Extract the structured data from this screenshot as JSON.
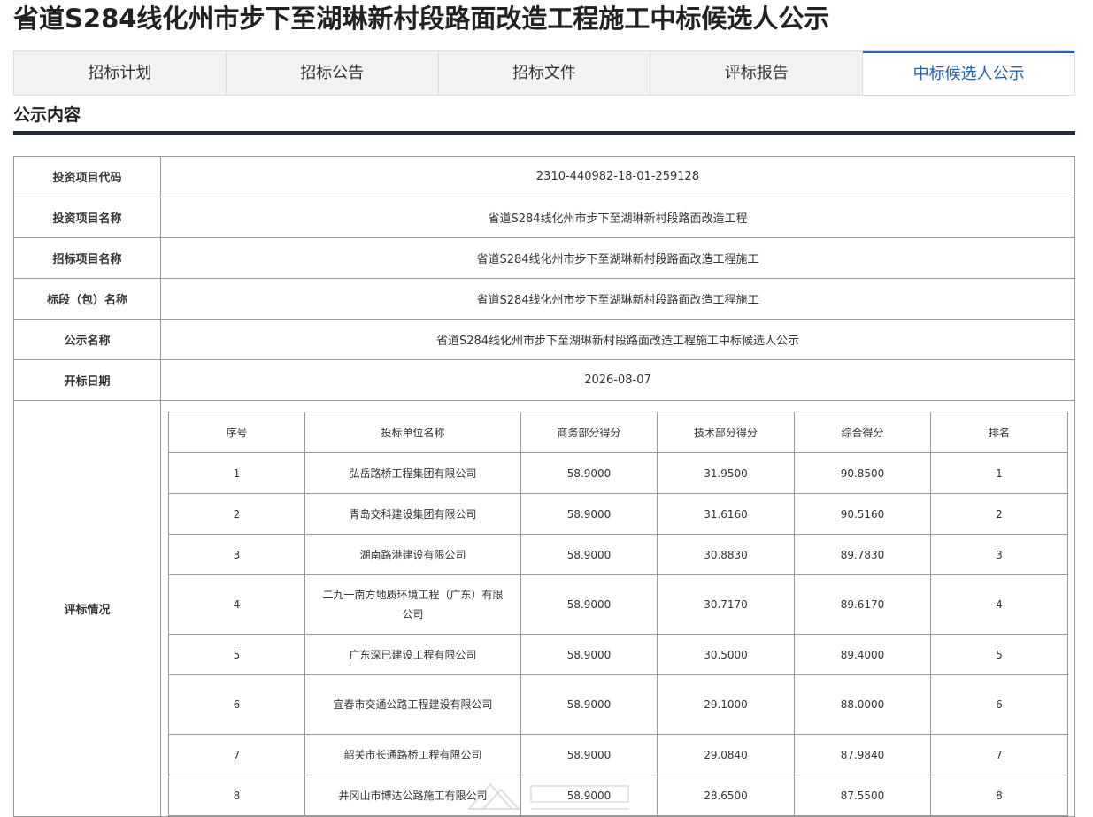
{
  "page": {
    "title": "省道S284线化州市步下至湖琳新村段路面改造工程施工中标候选人公示"
  },
  "tabs": [
    {
      "label": "招标计划"
    },
    {
      "label": "招标公告"
    },
    {
      "label": "招标文件"
    },
    {
      "label": "评标报告"
    },
    {
      "label": "中标候选人公示",
      "active": true
    }
  ],
  "section": {
    "title": "公示内容"
  },
  "info": {
    "project_code_label": "投资项目代码",
    "project_code": "2310-440982-18-01-259128",
    "project_name_label": "投资项目名称",
    "project_name": "省道S284线化州市步下至湖琳新村段路面改造工程",
    "tender_name_label": "招标项目名称",
    "tender_name": "省道S284线化州市步下至湖琳新村段路面改造工程施工",
    "section_name_label": "标段（包）名称",
    "section_name": "省道S284线化州市步下至湖琳新村段路面改造工程施工",
    "notice_name_label": "公示名称",
    "notice_name": "省道S284线化州市步下至湖琳新村段路面改造工程施工中标候选人公示",
    "open_date_label": "开标日期",
    "open_date": "2026-08-07",
    "evaluation_label": "评标情况"
  },
  "evaluation": {
    "headers": [
      "序号",
      "投标单位名称",
      "商务部分得分",
      "技术部分得分",
      "综合得分",
      "排名"
    ],
    "rows": [
      [
        "1",
        "弘岳路桥工程集团有限公司",
        "58.9000",
        "31.9500",
        "90.8500",
        "1"
      ],
      [
        "2",
        "青岛交科建设集团有限公司",
        "58.9000",
        "31.6160",
        "90.5160",
        "2"
      ],
      [
        "3",
        "湖南路港建设有限公司",
        "58.9000",
        "30.8830",
        "89.7830",
        "3"
      ],
      [
        "4",
        "二九一南方地质环境工程（广东）有限公司",
        "58.9000",
        "30.7170",
        "89.6170",
        "4"
      ],
      [
        "5",
        "广东深已建设工程有限公司",
        "58.9000",
        "30.5000",
        "89.4000",
        "5"
      ],
      [
        "6",
        "宜春市交通公路工程建设有限公司",
        "58.9000",
        "29.1000",
        "88.0000",
        "6"
      ],
      [
        "7",
        "韶关市长通路桥工程有限公司",
        "58.9000",
        "29.0840",
        "87.9840",
        "7"
      ],
      [
        "8",
        "井冈山市博达公路施工有限公司",
        "58.9000",
        "28.6500",
        "87.5500",
        "8"
      ]
    ]
  },
  "colors": {
    "accent": "#1f63b6",
    "section_rule": "#1f2d3d",
    "border": "#999999"
  }
}
